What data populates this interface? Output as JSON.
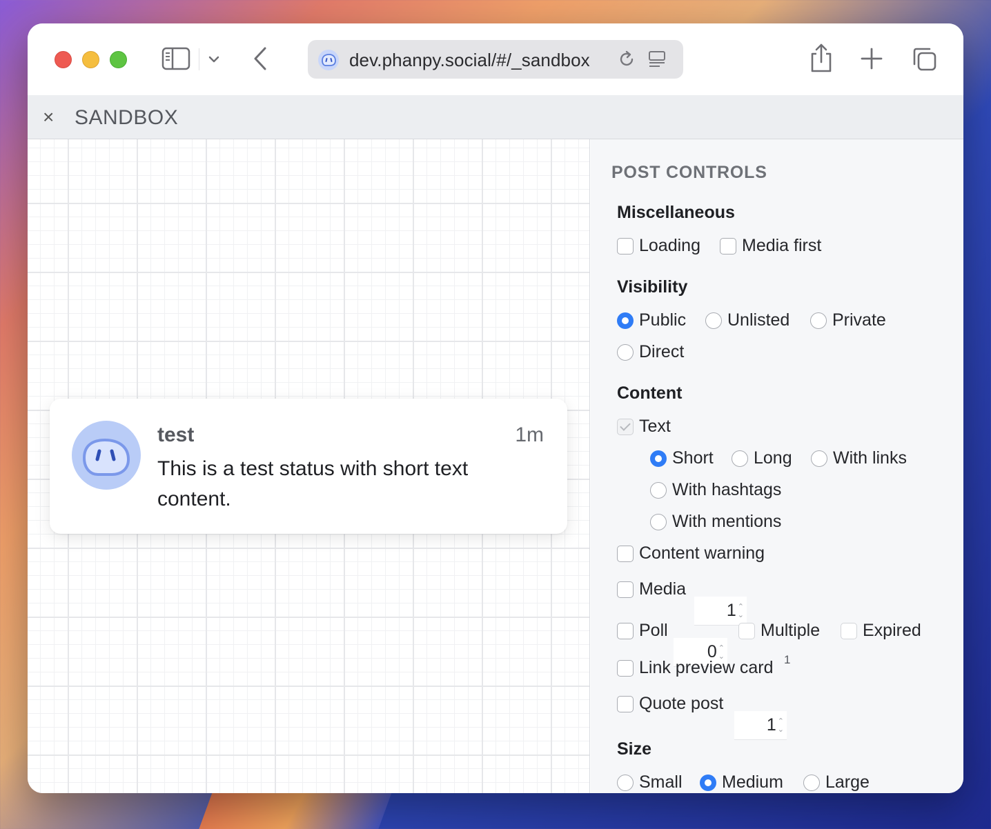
{
  "browser": {
    "url": "dev.phanpy.social/#/_sandbox"
  },
  "header": {
    "close_glyph": "×",
    "title": "SANDBOX"
  },
  "status": {
    "name": "test",
    "time": "1m",
    "text": "This is a test status with short text content."
  },
  "panel": {
    "title": "POST CONTROLS",
    "misc": {
      "title": "Miscellaneous",
      "loading": "Loading",
      "media_first": "Media first"
    },
    "visibility": {
      "title": "Visibility",
      "public": "Public",
      "unlisted": "Unlisted",
      "private": "Private",
      "direct": "Direct"
    },
    "content": {
      "title": "Content",
      "text": "Text",
      "short": "Short",
      "long": "Long",
      "with_links": "With links",
      "with_hashtags": "With hashtags",
      "with_mentions": "With mentions",
      "content_warning": "Content warning",
      "media": "Media",
      "media_count": "1",
      "poll": "Poll",
      "poll_count": "0",
      "multiple": "Multiple",
      "expired": "Expired",
      "link_preview": "Link preview card",
      "link_preview_sup": "1",
      "quote_post": "Quote post",
      "quote_count": "1"
    },
    "size": {
      "title": "Size",
      "small": "Small",
      "medium": "Medium",
      "large": "Large"
    }
  },
  "colors": {
    "accent": "#2f7cf6",
    "avatar_bg": "#b9ccf7"
  }
}
